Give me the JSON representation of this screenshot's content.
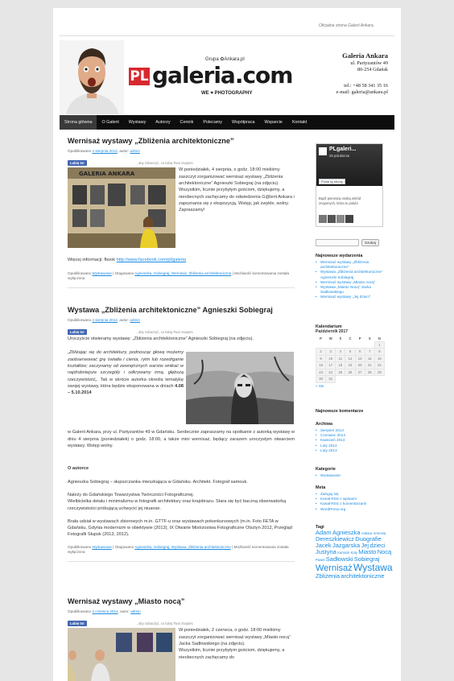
{
  "site": {
    "tagline": "Oficjalna strona Galerii Ankara.",
    "logo": {
      "prefix": "PL",
      "name": "galeria.com",
      "group": "Grupa ✿Ankara.pl",
      "sub": "WE ♥ PHOTOGRAPHY"
    },
    "contact": {
      "name": "Galeria Ankara",
      "street": "ul. Partyzantów 49",
      "city": "80-254 Gdańsk",
      "tel": "tel.: +48 58 341 35 16",
      "email": "e-mail: galeria@ankara.pl"
    }
  },
  "nav": [
    "Strona główna",
    "O Galerii",
    "Wystawy",
    "Autorzy",
    "Cennik",
    "Polecamy",
    "Współpraca",
    "Wsparcie",
    "Kontakt"
  ],
  "fb": {
    "like_label": "Lubię to!",
    "friends_text": ", aby zobaczyć, co lubią Twoi znajomi."
  },
  "posts": [
    {
      "title": "Wernisaż wystawy „Zbliżenia architektoniczne”",
      "meta_prefix": "Opublikowano",
      "date": "4 sierpnia 2014",
      "meta_mid": ", autor:",
      "author": "admin",
      "body": "W poniedziałek, 4 sierpnia, o godz. 18:00 mieliśmy zaszczyt zorganizować wernisaż wystawy „Zbliżenia architektoniczne” Agnieszki Sobiegraj (na zdjęciu). Wszystkim, licznie przybyłym gościom, dziękujemy, a nieobecnych zachęcamy do odwiedzenia G@lerii Ankara i zapoznania się z ekspozycją. Wstęp, jak zwykle, wolny. Zapraszamy!",
      "info_label": "Więcej informacji: fbook",
      "info_link": "http://www.facebook.com/pl/galeria",
      "footer_a": "Opublikowano",
      "footer_cat": "Wystawowe",
      "footer_b": "| Otagowano",
      "footer_tags": "Agnieszka, Sobiegraj, Wernisaż, Zbliżenia architektoniczne",
      "footer_c": "| Możliwość komentowania została wyłączona"
    },
    {
      "title": "Wystawa „Zbliżenia architektoniczne” Agnieszki Sobiegraj",
      "meta_prefix": "Opublikowano",
      "date": "4 sierpnia 2014",
      "meta_mid": ", autor:",
      "author": "admin",
      "intro": "Uroczyście otwieramy wystawę: „Zbliżenia architektoniczne” Agnieszki Sobiegraj (na zdjęciu).",
      "quote": "„Zbliżając się do architektury, podnosząc głowę możemy zaobserwować grę światła i cienia, rytm lub rozedrganie kształtów; zaczynamy od zewnętrznych warstw wnikać w najdrobniejsze szczegóły i odkrywamy inną, głębszą rzeczywistość„.",
      "after_quote": "Tak w skrócie autorka określa tematykę swojej wystawy, która będzie eksponowana w dniach",
      "dates_bold": "4.08 – 5.10.2014",
      "rest": "w Galerii Ankara, przy ul. Partyzantów 49 w Gdańsku. Serdecznie zapraszamy na spotkanie z autorką wystawy w dniu 4 sierpnia (poniedziałek) o godz. 18:00, a także mini wernisaż, będący zarazem uroczystym otwarciem wystawy. Wstęp wolny.",
      "about_heading": "O autorce",
      "about1": "Agnieszka Sobiegraj – słupszczanka mieszkająca w Gdańsku. Architekt. Fotograf samouk.",
      "about2": "Należy do Gdańskiego Towarzystwa Twórczości Fotograficznej.",
      "about3": "Wielbicielka detalu i minimalizmu w fotografii architektury oraz krajobrazu. Stara się być baczną obserwatorką rzeczywistości próbującą uchwycić jej niuanse.",
      "about4": "Brała udział w wystawach zbiorowych m.in. GTTF-u oraz wystawach pokonkursowych (m.in. Foto FETA w Gdańsku, Gdynia modernizm w obiektywie (2013), IX Otwarte Mistrzostwa Fotograficzne Olsztyn 2012, Przegląd Fotografii Słupsk (2013, 2012).",
      "footer_a": "Opublikowano",
      "footer_cat": "Wystawowe",
      "footer_b": "| Otagowano",
      "footer_tags": "Agnieszka, Sobiegraj, Wystawa, Zbliżenia architektoniczne",
      "footer_c": "| Możliwość komentowania została wyłączona"
    },
    {
      "title": "Wernisaż wystawy „Miasto nocą”",
      "meta_prefix": "Opublikowano",
      "date": "3 czerwca 2014",
      "meta_mid": ", autor:",
      "author": "admin",
      "body": "W poniedziałek, 2 czerwca, o godz. 18:00 mieliśmy zaszczyt zorganizować wernisaż wystawy „Miasto nocą” Jacka Sadłowskiego (na zdjęciu).",
      "body2": "Wszystkim, licznie przybyłym gościom, dziękujemy, a nieobecnych zachęcamy do"
    }
  ],
  "sidebar": {
    "fb_page": {
      "name": "PLgaleri...",
      "likes": "25 polubienia",
      "like_btn": "Polub tę stronę",
      "friends": "Bądź pierwszą osobą wśród znajomych, która to polubi"
    },
    "search_button": "Szukaj",
    "recent_title": "Najnowsze wydarzenia",
    "recent": [
      "Wernisaż wystawy „Zbliżenia architektoniczne”",
      "Wystawa „Zbliżenia architektoniczne” Agnieszki Sobiegraj",
      "Wernisaż wystawy „Miasto nocą”",
      "Wystawa „Miasto Nocą” Jacka Sadłowskiego",
      "Wernisaż wystawy „Jej dzieci”"
    ],
    "calendar_title": "Kalendarium",
    "calendar_month": "Październik 2017",
    "calendar_days": [
      "P",
      "W",
      "Ś",
      "C",
      "P",
      "S",
      "N"
    ],
    "calendar_weeks": [
      [
        "",
        "",
        "",
        "",
        "",
        "",
        "1"
      ],
      [
        "2",
        "3",
        "4",
        "5",
        "6",
        "7",
        "8"
      ],
      [
        "9",
        "10",
        "11",
        "12",
        "13",
        "14",
        "15"
      ],
      [
        "16",
        "17",
        "18",
        "19",
        "20",
        "21",
        "22"
      ],
      [
        "23",
        "24",
        "25",
        "26",
        "27",
        "28",
        "29"
      ],
      [
        "30",
        "31",
        "",
        "",
        "",
        "",
        ""
      ]
    ],
    "calendar_prev": "« Sie",
    "comments_title": "Najnowsze komentarze",
    "archive_title": "Archiwa",
    "archive": [
      "Sierpień 2014",
      "Czerwiec 2014",
      "Kwiecień 2014",
      "Luty 2014",
      "Luty 2013"
    ],
    "categories_title": "Kategorie",
    "categories": [
      "Wystawowe"
    ],
    "meta_title": "Meta",
    "meta": [
      "Zaloguj się",
      "Kanał RSS z wpisami",
      "Kanał RSS z komentarzami",
      "WordPress.org"
    ],
    "tags_title": "Tagi",
    "tags": [
      {
        "t": "Adam",
        "s": 7.5
      },
      {
        "t": "Agnieszka",
        "s": 7.5
      },
      {
        "t": "Ankara",
        "s": 4.2
      },
      {
        "t": "Armenia",
        "s": 4.2
      },
      {
        "t": "Dereszkiewicz",
        "s": 7.5
      },
      {
        "t": "Duografie",
        "s": 7.5
      },
      {
        "t": "Jacek",
        "s": 7.5
      },
      {
        "t": "Jazgarska",
        "s": 7.5
      },
      {
        "t": "Jej",
        "s": 7.5
      },
      {
        "t": "dzieci",
        "s": 7.5
      },
      {
        "t": "Justyna",
        "s": 7.5
      },
      {
        "t": "Karnicki",
        "s": 4.2
      },
      {
        "t": "Koty",
        "s": 4.2
      },
      {
        "t": "Miasto",
        "s": 7.5
      },
      {
        "t": "Nocą",
        "s": 7.5
      },
      {
        "t": "Paweł",
        "s": 4.2
      },
      {
        "t": "Sadłowski",
        "s": 7.5
      },
      {
        "t": "Sobiegraj",
        "s": 7.5
      },
      {
        "t": "Wernisaż",
        "s": 11
      },
      {
        "t": "Wystawa",
        "s": 12
      },
      {
        "t": "Zbliżenia",
        "s": 7.5
      },
      {
        "t": "architektoniczne",
        "s": 7.5
      }
    ]
  }
}
